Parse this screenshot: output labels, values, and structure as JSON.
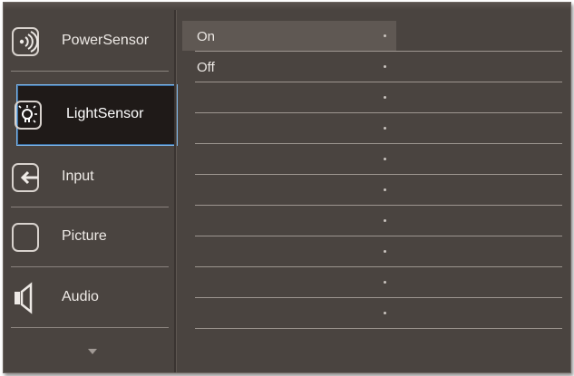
{
  "sidebar": {
    "items": [
      {
        "label": "PowerSensor",
        "icon": "power-sensor-icon",
        "selected": false
      },
      {
        "label": "LightSensor",
        "icon": "light-sensor-icon",
        "selected": true
      },
      {
        "label": "Input",
        "icon": "input-icon",
        "selected": false
      },
      {
        "label": "Picture",
        "icon": "picture-icon",
        "selected": false
      },
      {
        "label": "Audio",
        "icon": "audio-icon",
        "selected": false
      }
    ],
    "more_indicator": "scroll-down-arrow-icon"
  },
  "submenu": {
    "options": [
      {
        "label": "On",
        "highlighted": true
      },
      {
        "label": "Off",
        "highlighted": false
      },
      {
        "label": ""
      },
      {
        "label": ""
      },
      {
        "label": ""
      },
      {
        "label": ""
      },
      {
        "label": ""
      },
      {
        "label": ""
      },
      {
        "label": ""
      },
      {
        "label": ""
      }
    ]
  },
  "colors": {
    "panel": "#4a4440",
    "selected_bg": "#1f1a18",
    "selected_border": "#7fb7ea",
    "highlight": "#5f5853"
  }
}
